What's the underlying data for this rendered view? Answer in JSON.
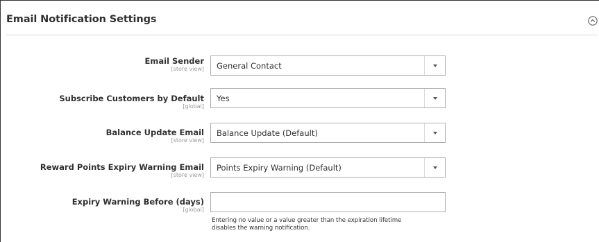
{
  "section": {
    "title": "Email Notification Settings",
    "collapse_icon": "chevron-up-circle-icon"
  },
  "fields": [
    {
      "label": "Email Sender",
      "scope": "[store view]",
      "type": "select",
      "value": "General Contact"
    },
    {
      "label": "Subscribe Customers by Default",
      "scope": "[global]",
      "type": "select",
      "value": "Yes"
    },
    {
      "label": "Balance Update Email",
      "scope": "[store view]",
      "type": "select",
      "value": "Balance Update (Default)"
    },
    {
      "label": "Reward Points Expiry Warning Email",
      "scope": "[store view]",
      "type": "select",
      "value": "Points Expiry Warning (Default)"
    },
    {
      "label": "Expiry Warning Before (days)",
      "scope": "[global]",
      "type": "text",
      "value": "",
      "note_line1": "Entering no value or a value greater than the expiration lifetime",
      "note_line2": "disables the warning notification."
    }
  ],
  "colors": {
    "text": "#303030",
    "scope": "#999999",
    "border": "#adadad"
  }
}
